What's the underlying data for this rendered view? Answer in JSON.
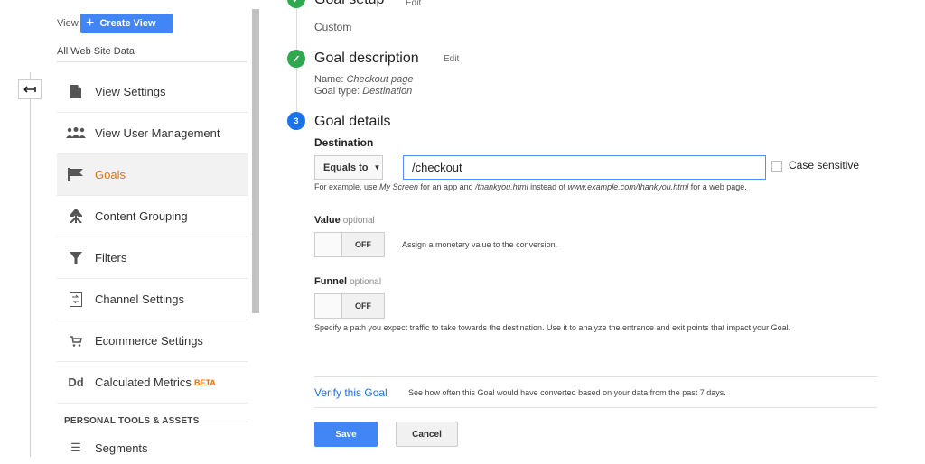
{
  "back": {
    "icon": "back-arrow-icon"
  },
  "sidebar": {
    "view_label": "View",
    "create_view_label": "Create View",
    "view_name": "All Web Site Data",
    "items": [
      {
        "label": "View Settings",
        "icon": "document-icon"
      },
      {
        "label": "View User Management",
        "icon": "users-icon"
      },
      {
        "label": "Goals",
        "icon": "flag-icon",
        "active": true
      },
      {
        "label": "Content Grouping",
        "icon": "grouping-icon"
      },
      {
        "label": "Filters",
        "icon": "filter-icon"
      },
      {
        "label": "Channel Settings",
        "icon": "channel-icon"
      },
      {
        "label": "Ecommerce Settings",
        "icon": "cart-icon"
      },
      {
        "label": "Calculated Metrics",
        "badge": "BETA",
        "icon": "dd-icon"
      }
    ],
    "section_title": "PERSONAL TOOLS & ASSETS",
    "segments_label": "Segments"
  },
  "goal_setup": {
    "title": "Goal setup",
    "edit": "Edit",
    "value": "Custom"
  },
  "goal_description": {
    "title": "Goal description",
    "edit": "Edit",
    "name_label": "Name:",
    "name_value": "Checkout page",
    "type_label": "Goal type:",
    "type_value": "Destination"
  },
  "goal_details": {
    "step_number": "3",
    "title": "Goal details",
    "destination_label": "Destination",
    "match_type": "Equals to",
    "destination_value": "/checkout",
    "case_sensitive_label": "Case sensitive",
    "example": {
      "p1": "For example, use ",
      "app_example": "My Screen",
      "p2": " for an app and ",
      "page_example": "/thankyou.html",
      "p3": " instead of ",
      "url_example": "www.example.com/thankyou.html",
      "p4": " for a web page."
    },
    "value_label": "Value",
    "value_optional": "optional",
    "value_toggle": "OFF",
    "value_desc": "Assign a monetary value to the conversion.",
    "funnel_label": "Funnel",
    "funnel_optional": "optional",
    "funnel_toggle": "OFF",
    "funnel_desc": "Specify a path you expect traffic to take towards the destination. Use it to analyze the entrance and exit points that impact your Goal."
  },
  "verify": {
    "link": "Verify this Goal",
    "desc": "See how often this Goal would have converted based on your data from the past 7 days."
  },
  "actions": {
    "save": "Save",
    "cancel": "Cancel"
  }
}
